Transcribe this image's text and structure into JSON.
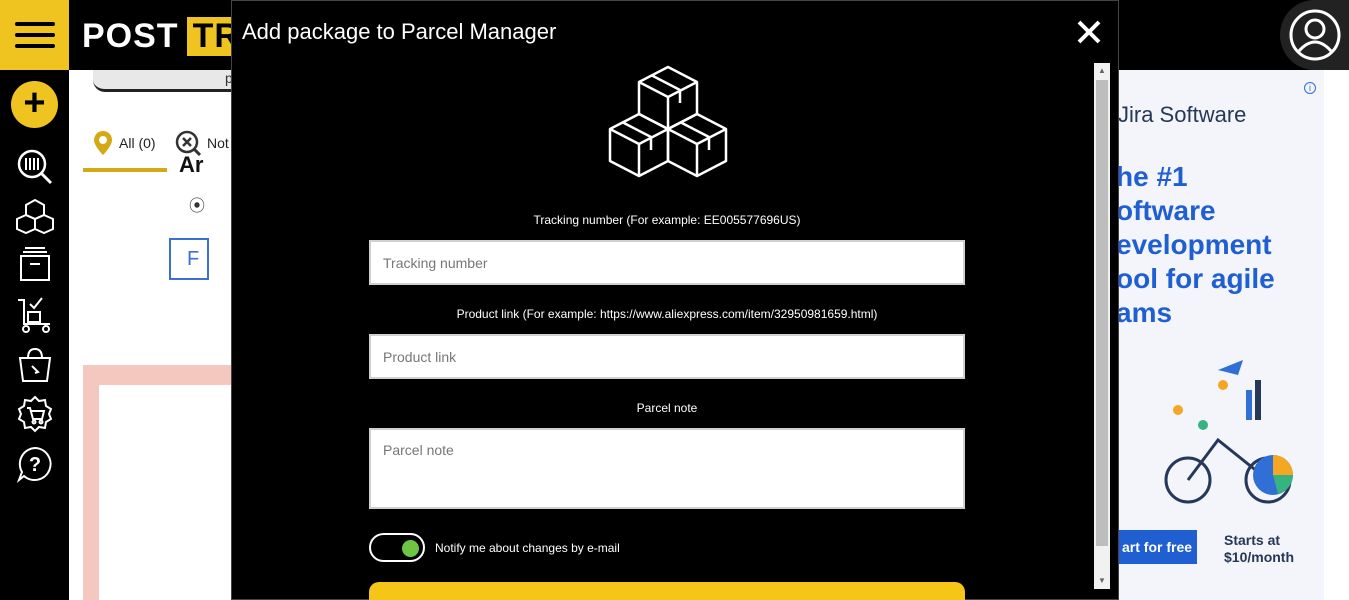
{
  "header": {
    "logo_text_white": "POST",
    "logo_text_yellow": "TR",
    "menu_icon": "hamburger-icon",
    "user_icon": "user-avatar-icon"
  },
  "sidebar": {
    "add_icon": "plus-icon",
    "add_label": "+",
    "items": [
      {
        "icon": "barcode-search-icon"
      },
      {
        "icon": "boxes-icon"
      },
      {
        "icon": "archive-icon"
      },
      {
        "icon": "delivery-truck-icon"
      },
      {
        "icon": "shopping-bag-icon"
      },
      {
        "icon": "shopping-cart-icon"
      },
      {
        "icon": "help-icon"
      }
    ]
  },
  "background_page": {
    "pill_text": "p",
    "filters": [
      {
        "label": "All (0)",
        "icon": "location-pin-icon",
        "active": true
      },
      {
        "label": "Not",
        "icon": "not-found-icon",
        "active": false
      }
    ],
    "card_title": "Ar",
    "card_radio": "⦿",
    "card_button": "F"
  },
  "ad": {
    "brand": "Jira Software",
    "headline_lines": [
      "he #1",
      "oftware",
      "evelopment",
      "ool for agile",
      "ams"
    ],
    "cta": "art for free",
    "price_line1": "Starts at",
    "price_line2": "$10/month",
    "info_icon": "info-icon"
  },
  "modal": {
    "title": "Add package to Parcel Manager",
    "close_icon": "close-icon",
    "hero_icon": "boxes-icon",
    "tracking": {
      "label": "Tracking number (For example: EE005577696US)",
      "placeholder": "Tracking number",
      "value": ""
    },
    "product": {
      "label": "Product link (For example: https://www.aliexpress.com/item/32950981659.html)",
      "placeholder": "Product link",
      "value": ""
    },
    "note": {
      "label": "Parcel note",
      "placeholder": "Parcel note",
      "value": ""
    },
    "notify": {
      "label": "Notify me about changes by e-mail",
      "checked": true
    }
  },
  "colors": {
    "brand_yellow": "#f0c420",
    "toggle_on": "#6cc644",
    "ad_blue": "#1f5fd1"
  }
}
